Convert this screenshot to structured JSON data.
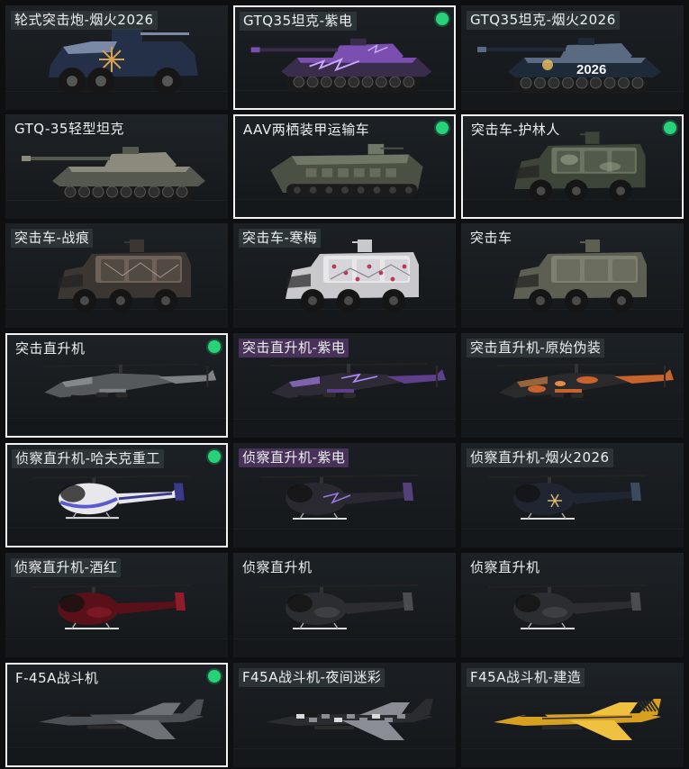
{
  "colors": {
    "selected_border": "#f2f2f2",
    "equipped_indicator": "#27d27a"
  },
  "cards": [
    {
      "label": "轮式突击炮-烟火2026",
      "kind": "wheeled-assault-gun",
      "label_style": "dark",
      "selected": false,
      "equipped": false,
      "paint": [
        "#243048",
        "#7a8aa6",
        "#d9a24a"
      ],
      "decal": "burst",
      "bg": "#1d2226"
    },
    {
      "label": "GTQ35坦克-紫电",
      "kind": "tank",
      "label_style": "dark",
      "selected": true,
      "equipped": true,
      "paint": [
        "#3a2d4c",
        "#7a4fb0",
        "#c8a8ff"
      ],
      "decal": "lightning",
      "bg": "#1c2024"
    },
    {
      "label": "GTQ35坦克-烟火2026",
      "kind": "tank",
      "label_style": "dark",
      "selected": false,
      "equipped": false,
      "paint": [
        "#1e2a38",
        "#5a6a80",
        "#f0c060"
      ],
      "decal": "2026",
      "bg": "#1b1f23"
    },
    {
      "label": "GTQ-35轻型坦克",
      "kind": "tank",
      "label_style": "plain",
      "selected": false,
      "equipped": false,
      "paint": [
        "#55584f",
        "#8b8a7c",
        "#b5b3a0"
      ],
      "decal": "none",
      "bg": "#1e2327"
    },
    {
      "label": "AAV两栖装甲运输车",
      "kind": "amphibious",
      "label_style": "plain",
      "selected": true,
      "equipped": true,
      "paint": [
        "#4a5144",
        "#6f7766",
        "#9aa08c"
      ],
      "decal": "none",
      "bg": "#1c2125"
    },
    {
      "label": "突击车-护林人",
      "kind": "assault-vehicle",
      "label_style": "plain",
      "selected": true,
      "equipped": true,
      "paint": [
        "#3d4538",
        "#6b7362",
        "#9aa38c"
      ],
      "decal": "camo",
      "bg": "#1d2226"
    },
    {
      "label": "突击车-战痕",
      "kind": "assault-vehicle",
      "label_style": "dark",
      "selected": false,
      "equipped": false,
      "paint": [
        "#3b3631",
        "#6e6258",
        "#a4958a"
      ],
      "decal": "scratch",
      "bg": "#1c2125"
    },
    {
      "label": "突击车-寒梅",
      "kind": "assault-vehicle",
      "label_style": "dark",
      "selected": false,
      "equipped": false,
      "paint": [
        "#c9c9cc",
        "#e7e7ea",
        "#b83a54"
      ],
      "decal": "plum",
      "bg": "#1b2024"
    },
    {
      "label": "突击车",
      "kind": "assault-vehicle",
      "label_style": "plain",
      "selected": false,
      "equipped": false,
      "paint": [
        "#5c5f52",
        "#7d8070",
        "#a6a890"
      ],
      "decal": "none",
      "bg": "#1d2226"
    },
    {
      "label": "突击直升机",
      "kind": "attack-heli",
      "label_style": "plain",
      "selected": true,
      "equipped": true,
      "paint": [
        "#55595c",
        "#7d8184",
        "#a4a8aa"
      ],
      "decal": "none",
      "bg": "#1d2226"
    },
    {
      "label": "突击直升机-紫电",
      "kind": "attack-heli",
      "label_style": "purple",
      "selected": false,
      "equipped": false,
      "paint": [
        "#2e2a36",
        "#5e3f8c",
        "#b48cff"
      ],
      "decal": "lightning",
      "bg": "#1b1f23"
    },
    {
      "label": "突击直升机-原始伪装",
      "kind": "attack-heli",
      "label_style": "dark",
      "selected": false,
      "equipped": false,
      "paint": [
        "#2a2a2c",
        "#c8632c",
        "#e58a48"
      ],
      "decal": "camo",
      "bg": "#1c2125"
    },
    {
      "label": "侦察直升机-哈夫克重工",
      "kind": "scout-heli",
      "label_style": "dark",
      "selected": true,
      "equipped": true,
      "paint": [
        "#e8e8ec",
        "#3a3a8a",
        "#5a5ad0"
      ],
      "decal": "stripe",
      "bg": "#1c2125"
    },
    {
      "label": "侦察直升机-紫电",
      "kind": "scout-heli",
      "label_style": "purple",
      "selected": false,
      "equipped": false,
      "paint": [
        "#2a2830",
        "#55407a",
        "#9a78e0"
      ],
      "decal": "lightning",
      "bg": "#1b1f23"
    },
    {
      "label": "侦察直升机-烟火2026",
      "kind": "scout-heli",
      "label_style": "dark",
      "selected": false,
      "equipped": false,
      "paint": [
        "#1f2632",
        "#3c4a60",
        "#e8c070"
      ],
      "decal": "burst",
      "bg": "#1c2125"
    },
    {
      "label": "侦察直升机-酒红",
      "kind": "scout-heli",
      "label_style": "dark",
      "selected": false,
      "equipped": false,
      "paint": [
        "#5a1018",
        "#8e1c2a",
        "#c84050"
      ],
      "decal": "none",
      "bg": "#1d2226"
    },
    {
      "label": "侦察直升机",
      "kind": "scout-heli",
      "label_style": "plain",
      "selected": false,
      "equipped": false,
      "paint": [
        "#2c2d30",
        "#4a4c50",
        "#6c6e72"
      ],
      "decal": "none",
      "bg": "#1c2125"
    },
    {
      "label": "侦察直升机",
      "kind": "scout-heli",
      "label_style": "plain",
      "selected": false,
      "equipped": false,
      "paint": [
        "#2c2d30",
        "#4a4c50",
        "#6c6e72"
      ],
      "decal": "none",
      "bg": "#1d2226"
    },
    {
      "label": "F-45A战斗机",
      "kind": "jet",
      "label_style": "plain",
      "selected": true,
      "equipped": true,
      "paint": [
        "#4c5054",
        "#6e7276",
        "#9a9ea2"
      ],
      "decal": "none",
      "bg": "#1c2125"
    },
    {
      "label": "F45A战斗机-夜间迷彩",
      "kind": "jet",
      "label_style": "dark",
      "selected": false,
      "equipped": false,
      "paint": [
        "#2a2c30",
        "#8a8e94",
        "#d8dadc"
      ],
      "decal": "camo",
      "bg": "#1b1f23"
    },
    {
      "label": "F45A战斗机-建造",
      "kind": "jet",
      "label_style": "dark",
      "selected": false,
      "equipped": false,
      "paint": [
        "#d8a020",
        "#f0c040",
        "#2a2a2a"
      ],
      "decal": "stripe",
      "bg": "#1d2226"
    }
  ]
}
